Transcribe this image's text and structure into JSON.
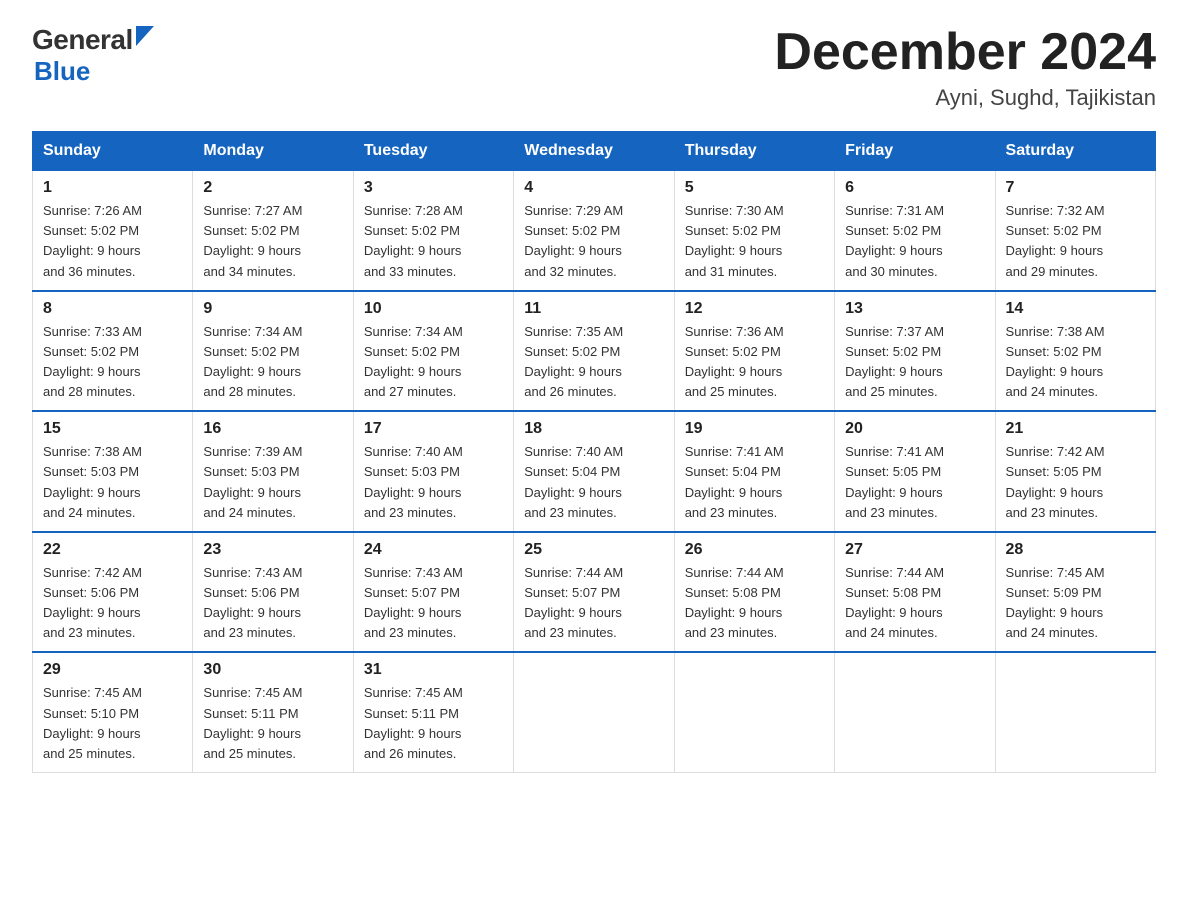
{
  "header": {
    "logo_general": "General",
    "logo_blue": "Blue",
    "month_title": "December 2024",
    "location": "Ayni, Sughd, Tajikistan"
  },
  "days_of_week": [
    "Sunday",
    "Monday",
    "Tuesday",
    "Wednesday",
    "Thursday",
    "Friday",
    "Saturday"
  ],
  "weeks": [
    [
      {
        "day": "1",
        "sunrise": "7:26 AM",
        "sunset": "5:02 PM",
        "daylight": "9 hours and 36 minutes."
      },
      {
        "day": "2",
        "sunrise": "7:27 AM",
        "sunset": "5:02 PM",
        "daylight": "9 hours and 34 minutes."
      },
      {
        "day": "3",
        "sunrise": "7:28 AM",
        "sunset": "5:02 PM",
        "daylight": "9 hours and 33 minutes."
      },
      {
        "day": "4",
        "sunrise": "7:29 AM",
        "sunset": "5:02 PM",
        "daylight": "9 hours and 32 minutes."
      },
      {
        "day": "5",
        "sunrise": "7:30 AM",
        "sunset": "5:02 PM",
        "daylight": "9 hours and 31 minutes."
      },
      {
        "day": "6",
        "sunrise": "7:31 AM",
        "sunset": "5:02 PM",
        "daylight": "9 hours and 30 minutes."
      },
      {
        "day": "7",
        "sunrise": "7:32 AM",
        "sunset": "5:02 PM",
        "daylight": "9 hours and 29 minutes."
      }
    ],
    [
      {
        "day": "8",
        "sunrise": "7:33 AM",
        "sunset": "5:02 PM",
        "daylight": "9 hours and 28 minutes."
      },
      {
        "day": "9",
        "sunrise": "7:34 AM",
        "sunset": "5:02 PM",
        "daylight": "9 hours and 28 minutes."
      },
      {
        "day": "10",
        "sunrise": "7:34 AM",
        "sunset": "5:02 PM",
        "daylight": "9 hours and 27 minutes."
      },
      {
        "day": "11",
        "sunrise": "7:35 AM",
        "sunset": "5:02 PM",
        "daylight": "9 hours and 26 minutes."
      },
      {
        "day": "12",
        "sunrise": "7:36 AM",
        "sunset": "5:02 PM",
        "daylight": "9 hours and 25 minutes."
      },
      {
        "day": "13",
        "sunrise": "7:37 AM",
        "sunset": "5:02 PM",
        "daylight": "9 hours and 25 minutes."
      },
      {
        "day": "14",
        "sunrise": "7:38 AM",
        "sunset": "5:02 PM",
        "daylight": "9 hours and 24 minutes."
      }
    ],
    [
      {
        "day": "15",
        "sunrise": "7:38 AM",
        "sunset": "5:03 PM",
        "daylight": "9 hours and 24 minutes."
      },
      {
        "day": "16",
        "sunrise": "7:39 AM",
        "sunset": "5:03 PM",
        "daylight": "9 hours and 24 minutes."
      },
      {
        "day": "17",
        "sunrise": "7:40 AM",
        "sunset": "5:03 PM",
        "daylight": "9 hours and 23 minutes."
      },
      {
        "day": "18",
        "sunrise": "7:40 AM",
        "sunset": "5:04 PM",
        "daylight": "9 hours and 23 minutes."
      },
      {
        "day": "19",
        "sunrise": "7:41 AM",
        "sunset": "5:04 PM",
        "daylight": "9 hours and 23 minutes."
      },
      {
        "day": "20",
        "sunrise": "7:41 AM",
        "sunset": "5:05 PM",
        "daylight": "9 hours and 23 minutes."
      },
      {
        "day": "21",
        "sunrise": "7:42 AM",
        "sunset": "5:05 PM",
        "daylight": "9 hours and 23 minutes."
      }
    ],
    [
      {
        "day": "22",
        "sunrise": "7:42 AM",
        "sunset": "5:06 PM",
        "daylight": "9 hours and 23 minutes."
      },
      {
        "day": "23",
        "sunrise": "7:43 AM",
        "sunset": "5:06 PM",
        "daylight": "9 hours and 23 minutes."
      },
      {
        "day": "24",
        "sunrise": "7:43 AM",
        "sunset": "5:07 PM",
        "daylight": "9 hours and 23 minutes."
      },
      {
        "day": "25",
        "sunrise": "7:44 AM",
        "sunset": "5:07 PM",
        "daylight": "9 hours and 23 minutes."
      },
      {
        "day": "26",
        "sunrise": "7:44 AM",
        "sunset": "5:08 PM",
        "daylight": "9 hours and 23 minutes."
      },
      {
        "day": "27",
        "sunrise": "7:44 AM",
        "sunset": "5:08 PM",
        "daylight": "9 hours and 24 minutes."
      },
      {
        "day": "28",
        "sunrise": "7:45 AM",
        "sunset": "5:09 PM",
        "daylight": "9 hours and 24 minutes."
      }
    ],
    [
      {
        "day": "29",
        "sunrise": "7:45 AM",
        "sunset": "5:10 PM",
        "daylight": "9 hours and 25 minutes."
      },
      {
        "day": "30",
        "sunrise": "7:45 AM",
        "sunset": "5:11 PM",
        "daylight": "9 hours and 25 minutes."
      },
      {
        "day": "31",
        "sunrise": "7:45 AM",
        "sunset": "5:11 PM",
        "daylight": "9 hours and 26 minutes."
      },
      null,
      null,
      null,
      null
    ]
  ],
  "labels": {
    "sunrise": "Sunrise:",
    "sunset": "Sunset:",
    "daylight": "Daylight:"
  }
}
